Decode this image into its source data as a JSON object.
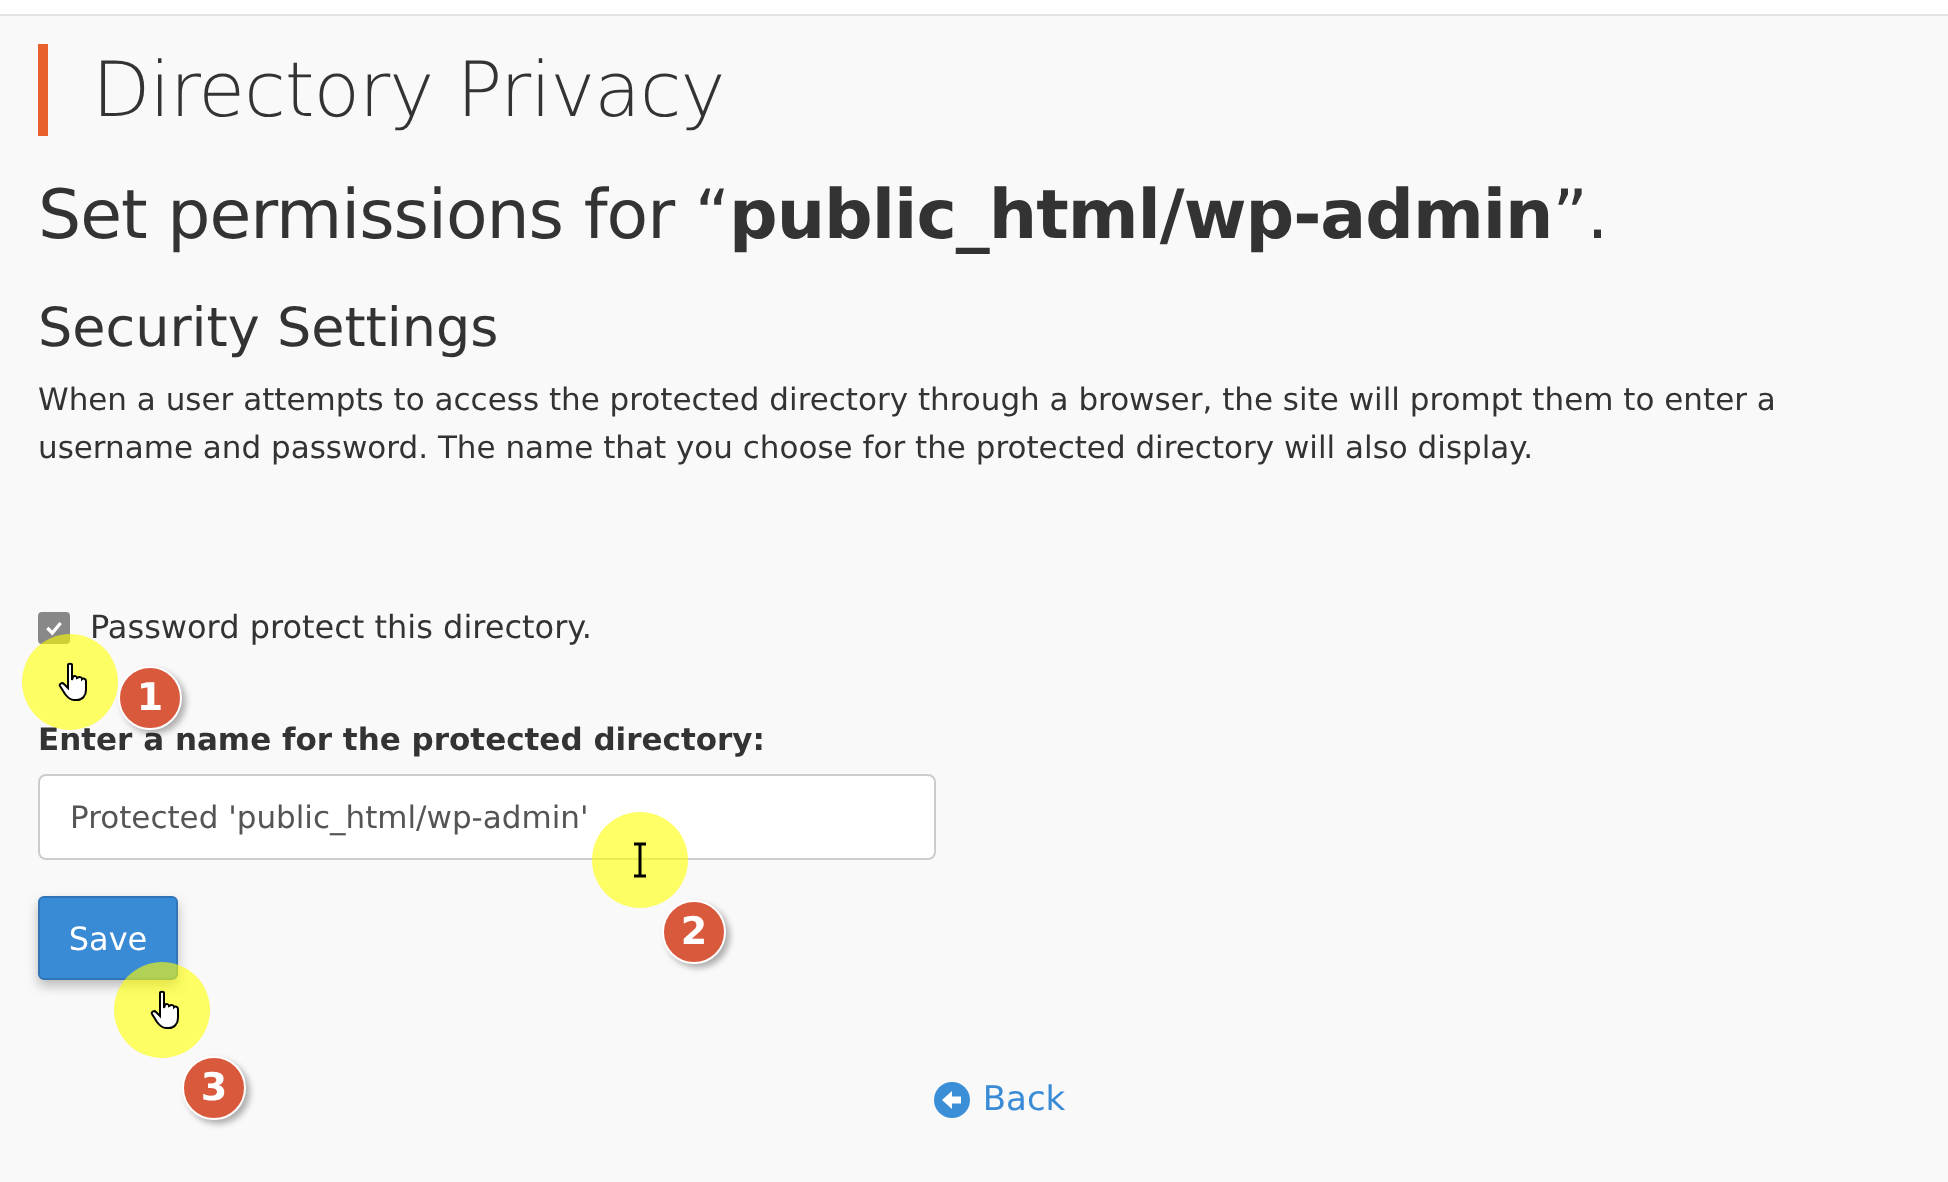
{
  "title": "Directory Privacy",
  "heading": "Set permissions for “**public_html/wp-admin**”.",
  "section": {
    "title": "Security Settings",
    "description": "When a user attempts to access the protected directory through a browser, the site will prompt them to enter a username and password. The name that you choose for the protected directory will also display."
  },
  "protect_checkbox": {
    "label": "Password protect this directory.",
    "checked": true
  },
  "name_field": {
    "label": "Enter a name for the protected directory:",
    "value": "Protected 'public_html/wp-admin'"
  },
  "save_button": "Save",
  "back_link": "Back",
  "annotations": [
    {
      "number": "1",
      "kind": "hand"
    },
    {
      "number": "2",
      "kind": "text"
    },
    {
      "number": "3",
      "kind": "hand"
    }
  ]
}
